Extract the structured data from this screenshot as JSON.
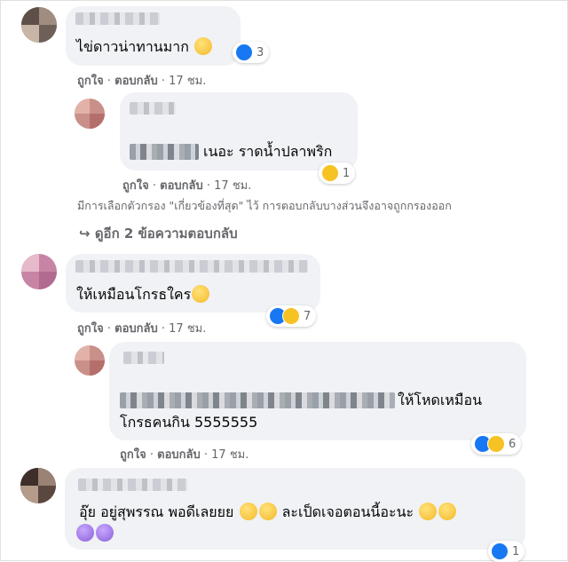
{
  "comments": [
    {
      "text": "ไข่ดาวน่าทานมาก",
      "reaction_count": "3",
      "actions": {
        "like": "ถูกใจ",
        "reply": "ตอบกลับ",
        "time": "17 ชม."
      }
    },
    {
      "text": "เนอะ ราดน้ำปลาพริก",
      "reaction_count": "1",
      "actions": {
        "like": "ถูกใจ",
        "reply": "ตอบกลับ",
        "time": "17 ชม."
      }
    },
    {
      "text": "ให้เหมือนโกรธใคร",
      "reaction_count": "7",
      "actions": {
        "like": "ถูกใจ",
        "reply": "ตอบกลับ",
        "time": "17 ชม."
      }
    },
    {
      "line1": "ให้โหดเหมือน",
      "line2": "โกรธคนกิน 5555555",
      "reaction_count": "6",
      "actions": {
        "like": "ถูกใจ",
        "reply": "ตอบกลับ",
        "time": "17 ชม."
      }
    },
    {
      "text1": "อุ๊ย อยู่สุพรรณ พอดีเลยยย",
      "text2": "ละเป็ดเจอตอนนี้อะนะ",
      "reaction_count": "1"
    }
  ],
  "filter_note": "มีการเลือกตัวกรอง \"เกี่ยวข้องที่สุด\" ไว้ การตอบกลับบางส่วนจึงอาจถูกกรองออก",
  "more_replies": "ดูอีก 2 ข้อความตอบกลับ",
  "separator": "·",
  "colors": {
    "bubble": "#f0f2f5",
    "meta": "#65676b",
    "like": "#1877f2",
    "emoji": "#f7c324"
  }
}
